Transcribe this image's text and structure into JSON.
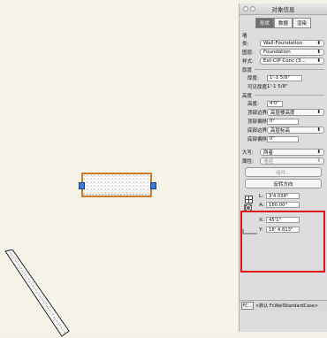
{
  "palette": {
    "title": "对象信息",
    "tabs": [
      "形状",
      "数据",
      "渲染"
    ],
    "tab_extra": "",
    "object_type": "墙",
    "fields": {
      "style_label": "类:",
      "style_value": "Wall-Foundation",
      "layer_label": "图层:",
      "layer_value": "Foundation",
      "material_label": "样式:",
      "material_value": "Ext-CIP Conc (3...",
      "thickness_section": "厚度",
      "thickness_label": "厚度:",
      "thickness_value": "1'-1 5/8\"",
      "visible_thickness_label": "可见厚度:",
      "visible_thickness_value": "1'-1 5/8\"",
      "height_section": "高度",
      "height_label": "高度:",
      "height_value": "4'0\"",
      "top_bound_label": "顶部边界:",
      "top_bound_value": "高层楼高度",
      "top_offset_label": "顶部偏移:",
      "top_offset_value": "0\"",
      "bottom_bound_label": "底部边界:",
      "bottom_bound_value": "高层标高",
      "bottom_offset_label": "底部偏移:",
      "bottom_offset_value": "0\"",
      "cap_label": "大写:",
      "cap_value": "两者",
      "attr_label": "属性:",
      "attr_value": "墙组",
      "component_button": "组件...",
      "reverse_button": "反转方向"
    },
    "geometry": {
      "L_label": "L:",
      "L_value": "3'4.038\"",
      "A_label": "A:",
      "A_value": "180.00°",
      "X_label": "X:",
      "X_value": "45'1\"",
      "Y_label": "Y:",
      "Y_value": "18' 4.813\""
    },
    "footer": {
      "button": "FC...",
      "label": "<默认 FcWallStandardCase>"
    }
  },
  "colors": {
    "selection": "#d07a2a",
    "handle": "#3a7bd5",
    "highlight": "#e3131b"
  }
}
